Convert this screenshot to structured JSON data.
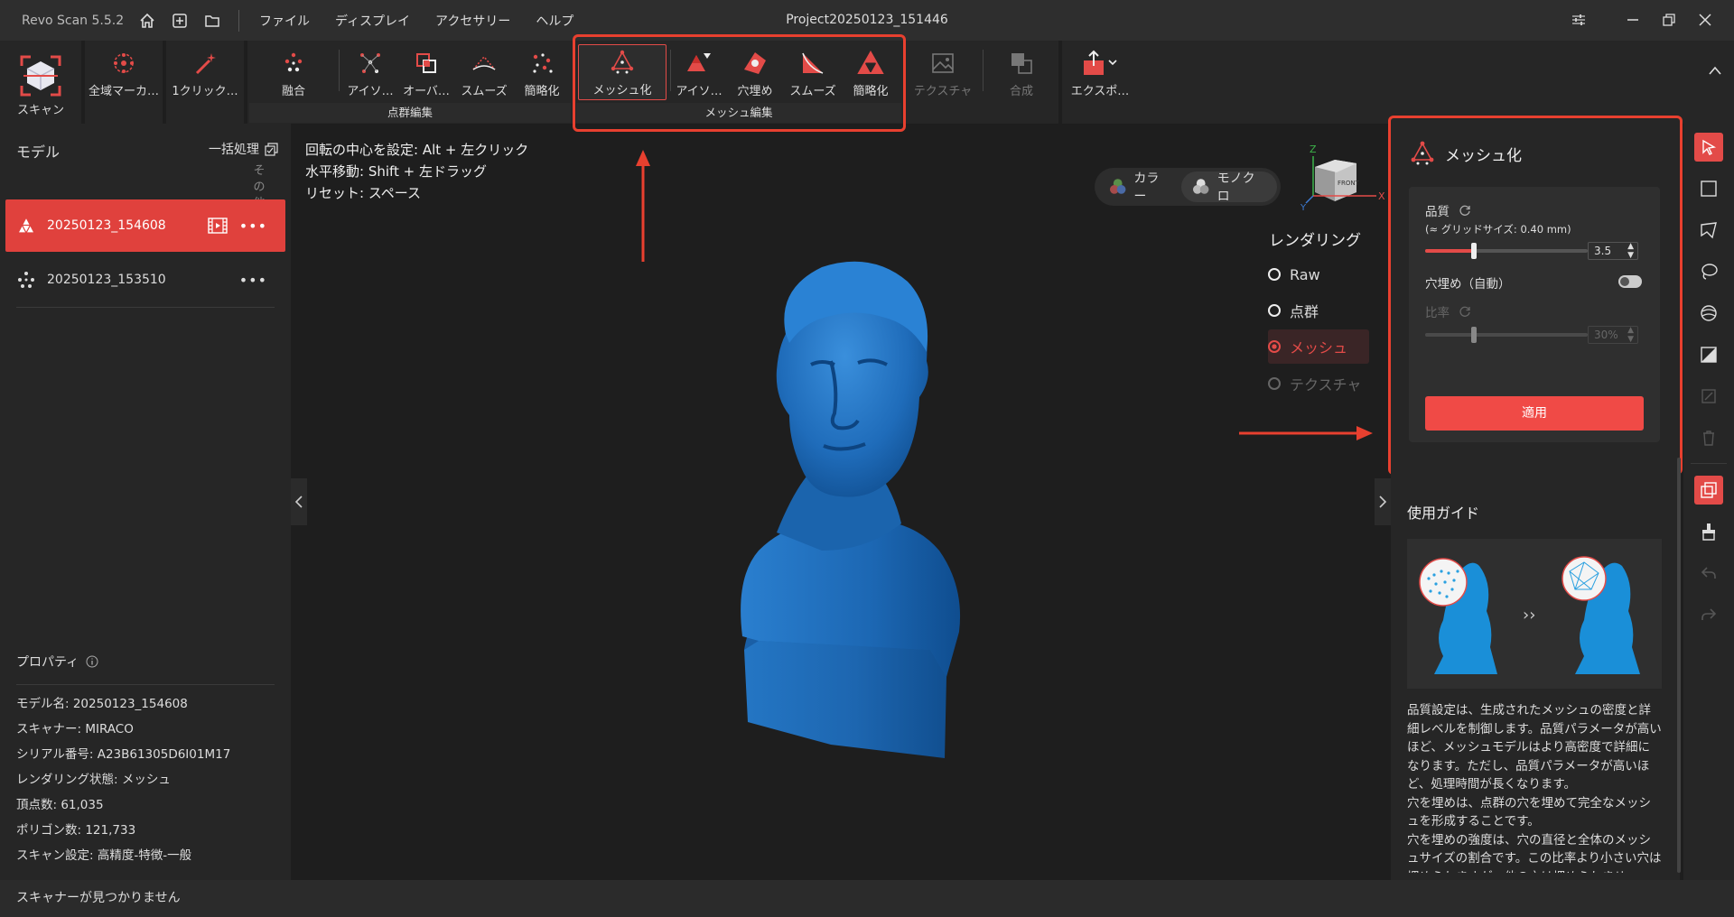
{
  "app": {
    "name": "Revo Scan 5.5.2",
    "project": "Project20250123_151446"
  },
  "menu": [
    "ファイル",
    "ディスプレイ",
    "アクセサリー",
    "ヘルプ"
  ],
  "toolbar": {
    "scan": "スキャン",
    "global_marker": "全域マーカ…",
    "one_click": "1クリック…",
    "fuse": "融合",
    "isolate": "アイソ…",
    "overlap": "オーバ…",
    "smooth": "スムーズ",
    "simplify": "簡略化",
    "meshing": "メッシュ化",
    "mesh_isolate": "アイソ…",
    "fill_holes": "穴埋め",
    "mesh_smooth": "スムーズ",
    "mesh_simplify": "簡略化",
    "texture": "テクスチャ",
    "merge": "合成",
    "export": "エクスポ…",
    "group_point": "点群編集",
    "group_mesh": "メッシュ編集"
  },
  "left": {
    "title": "モデル",
    "batch": "一括処理",
    "other": "その他",
    "models": [
      {
        "name": "20250123_154608"
      },
      {
        "name": "20250123_153510"
      }
    ],
    "props_title": "プロパティ",
    "props": [
      "モデル名:  20250123_154608",
      "スキャナー:  MIRACO",
      "シリアル番号:  A23B61305D6I01M17",
      "レンダリング状態:  メッシュ",
      "頂点数:  61,035",
      "ポリゴン数:  121,733",
      "スキャン設定:  高精度-特徴-一般"
    ]
  },
  "viewport": {
    "hints": [
      "回転の中心を設定: Alt + 左クリック",
      "水平移動: Shift + 左ドラッグ",
      "リセット: スペース"
    ],
    "color": "カラー",
    "mono": "モノクロ",
    "cube_front": "FRONT",
    "axis_z": "Z",
    "axis_x": "X",
    "axis_y": "Y",
    "render_title": "レンダリング",
    "render_opts": [
      "Raw",
      "点群",
      "メッシュ",
      "テクスチャ"
    ]
  },
  "panel": {
    "title": "メッシュ化",
    "quality": "品質",
    "grid": "(≈ グリッドサイズ: 0.40 mm)",
    "quality_value": "3.5",
    "quality_level": 0.3,
    "fill": "穴埋め（自動）",
    "ratio": "比率",
    "ratio_value": "30%",
    "ratio_level": 0.3,
    "apply": "適用",
    "guide": "使用ガイド",
    "guide_text": "品質設定は、生成されたメッシュの密度と詳細レベルを制御します。品質パラメータが高いほど、メッシュモデルはより高密度で詳細になります。ただし、品質パラメータが高いほど、処理時間が長くなります。\n穴を埋めは、点群の穴を埋めて完全なメッシュを形成することです。\n穴を埋めの強度は、穴の直径と全体のメッシュサイズの割合です。この比率より小さい穴は埋められますが、他の穴は埋められませ"
  },
  "status": "スキャナーが見つかりません",
  "colors": {
    "accent": "#e34b48",
    "mesh": "#1f74c4",
    "annotation": "#e8402f"
  }
}
